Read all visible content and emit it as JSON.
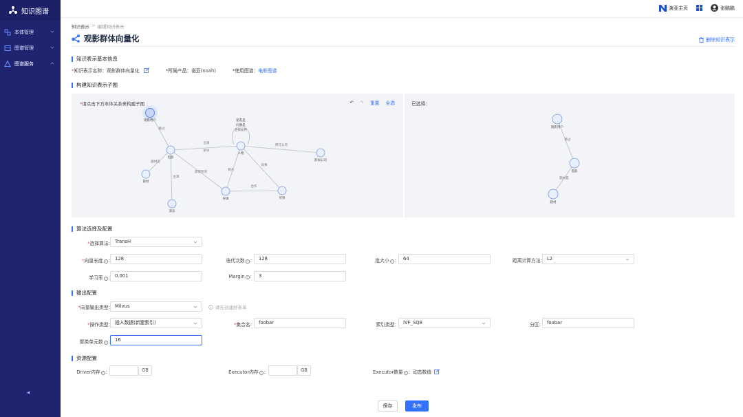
{
  "app": {
    "title": "知识图谱"
  },
  "sidebar": {
    "items": [
      {
        "label": "本体管理",
        "icon": "ontology-icon"
      },
      {
        "label": "图谱管理",
        "icon": "graph-manage-icon"
      },
      {
        "label": "图谱服务",
        "icon": "graph-service-icon"
      }
    ]
  },
  "topbar": {
    "home": "演亚主页",
    "user": "张鹏鹏"
  },
  "breadcrumb": {
    "root": "知识表示",
    "sep": ">",
    "current": "编辑知识表示"
  },
  "page": {
    "title": "观影群体向量化",
    "delete_label": "删除知识表示"
  },
  "sections": {
    "basic_info": "知识表示基本信息",
    "subgraph": "构建知识表示子图",
    "algorithm": "算法选择及配置",
    "output": "输出配置",
    "resource": "资源配置"
  },
  "basic_info": {
    "name_label": "知识表示名称：",
    "name_value": "观影群体向量化",
    "product_label": "*所属产品：",
    "product_value": "诺亚(noah)",
    "graph_label": "*使用图谱：",
    "graph_value": "电影图谱"
  },
  "graph": {
    "hint": "请点击下方本体关系来构建子图",
    "reset": "重置",
    "select_all": "全选",
    "selected_label": "已选择：",
    "left_nodes": [
      {
        "label": "观影用户"
      },
      {
        "label": "电影"
      },
      {
        "label": "题材"
      },
      {
        "label": "演员"
      },
      {
        "label": "人物"
      },
      {
        "label": "角色"
      },
      {
        "label": "导演"
      },
      {
        "label": "奖项"
      },
      {
        "label": "影视公司"
      }
    ],
    "left_edges": [
      {
        "label": "看过"
      },
      {
        "label": "题材是"
      },
      {
        "label": "主演"
      },
      {
        "label": "出演"
      },
      {
        "label": "执导"
      },
      {
        "label": "获得奖项"
      },
      {
        "label": "制片"
      },
      {
        "label": "同事"
      },
      {
        "label": "合作"
      },
      {
        "label": "朋友"
      },
      {
        "label": "所在公司"
      },
      {
        "label": "颁奖"
      }
    ],
    "loop_labels": [
      "朋友是",
      "同事是",
      "合作伙伴"
    ],
    "right_nodes": [
      {
        "label": "观影用户"
      },
      {
        "label": "电影"
      },
      {
        "label": "题材"
      }
    ],
    "right_edges": [
      {
        "label": "看过"
      },
      {
        "label": "题材是"
      }
    ]
  },
  "algorithm": {
    "select_label": "选择算法:",
    "select_value": "TransH",
    "vec_len_label": "向量长度",
    "vec_len_value": "128",
    "iter_label": "迭代次数",
    "iter_value": "128",
    "batch_label": "批大小",
    "batch_value": "64",
    "dist_label": "距离计算方法:",
    "dist_value": "L2",
    "lr_label": "学习率",
    "lr_value": "0.001",
    "margin_label": "Margin",
    "margin_value": "3"
  },
  "output": {
    "type_label": "向量输出类型:",
    "type_value": "Milvus",
    "type_hint": "请先创建好表单",
    "op_label": "操作类型:",
    "op_value": "插入数据(新建索引)",
    "collection_label": "集合名:",
    "collection_value": "foobar",
    "index_label": "索引类型:",
    "index_value": "IVF_SQ8",
    "partition_label": "分区:",
    "partition_value": "foobar",
    "cluster_label": "聚类单元数",
    "cluster_value": "16"
  },
  "resource": {
    "driver_label": "Driver内存",
    "driver_unit": "GB",
    "executor_mem_label": "Executor内存",
    "executor_unit": "GB",
    "executor_count_label": "Executor数量",
    "executor_count_value": "动态数值"
  },
  "actions": {
    "save": "保存",
    "publish": "发布"
  },
  "colors": {
    "accent": "#3370ff",
    "sidebar": "#1e2470",
    "required": "#e34d59"
  }
}
